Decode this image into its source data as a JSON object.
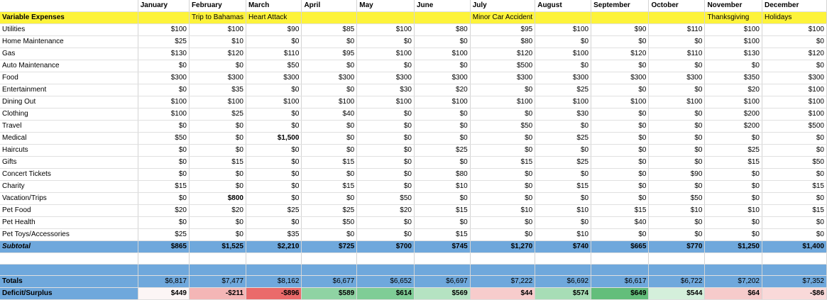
{
  "months": [
    "January",
    "February",
    "March",
    "April",
    "May",
    "June",
    "July",
    "August",
    "September",
    "October",
    "November",
    "December"
  ],
  "events_label": "Variable Expenses",
  "events": [
    "",
    "Trip to Bahamas",
    "Heart Attack",
    "",
    "",
    "",
    "Minor Car Accident",
    "",
    "",
    "",
    "Thanksgiving",
    "Holidays"
  ],
  "expenses": [
    {
      "label": "Utilities",
      "values": [
        "$100",
        "$100",
        "$90",
        "$85",
        "$100",
        "$80",
        "$95",
        "$100",
        "$90",
        "$110",
        "$100",
        "$100"
      ]
    },
    {
      "label": "Home Maintenance",
      "values": [
        "$25",
        "$10",
        "$0",
        "$0",
        "$0",
        "$0",
        "$80",
        "$0",
        "$0",
        "$0",
        "$100",
        "$0"
      ]
    },
    {
      "label": "Gas",
      "values": [
        "$130",
        "$120",
        "$110",
        "$95",
        "$100",
        "$100",
        "$120",
        "$100",
        "$120",
        "$110",
        "$130",
        "$120"
      ]
    },
    {
      "label": "Auto Maintenance",
      "values": [
        "$0",
        "$0",
        "$50",
        "$0",
        "$0",
        "$0",
        "$500",
        "$0",
        "$0",
        "$0",
        "$0",
        "$0"
      ]
    },
    {
      "label": "Food",
      "values": [
        "$300",
        "$300",
        "$300",
        "$300",
        "$300",
        "$300",
        "$300",
        "$300",
        "$300",
        "$300",
        "$350",
        "$300"
      ]
    },
    {
      "label": "Entertainment",
      "values": [
        "$0",
        "$35",
        "$0",
        "$0",
        "$30",
        "$20",
        "$0",
        "$25",
        "$0",
        "$0",
        "$20",
        "$100"
      ]
    },
    {
      "label": "Dining Out",
      "values": [
        "$100",
        "$100",
        "$100",
        "$100",
        "$100",
        "$100",
        "$100",
        "$100",
        "$100",
        "$100",
        "$100",
        "$100"
      ]
    },
    {
      "label": "Clothing",
      "values": [
        "$100",
        "$25",
        "$0",
        "$40",
        "$0",
        "$0",
        "$0",
        "$30",
        "$0",
        "$0",
        "$200",
        "$100"
      ]
    },
    {
      "label": "Travel",
      "values": [
        "$0",
        "$0",
        "$0",
        "$0",
        "$0",
        "$0",
        "$50",
        "$0",
        "$0",
        "$0",
        "$200",
        "$500"
      ]
    },
    {
      "label": "Medical",
      "values": [
        "$50",
        "$0",
        "$1,500",
        "$0",
        "$0",
        "$0",
        "$0",
        "$25",
        "$0",
        "$0",
        "$0",
        "$0"
      ]
    },
    {
      "label": "Haircuts",
      "values": [
        "$0",
        "$0",
        "$0",
        "$0",
        "$0",
        "$25",
        "$0",
        "$0",
        "$0",
        "$0",
        "$25",
        "$0"
      ]
    },
    {
      "label": "Gifts",
      "values": [
        "$0",
        "$15",
        "$0",
        "$15",
        "$0",
        "$0",
        "$15",
        "$25",
        "$0",
        "$0",
        "$15",
        "$50"
      ]
    },
    {
      "label": "Concert Tickets",
      "values": [
        "$0",
        "$0",
        "$0",
        "$0",
        "$0",
        "$80",
        "$0",
        "$0",
        "$0",
        "$90",
        "$0",
        "$0"
      ]
    },
    {
      "label": "Charity",
      "values": [
        "$15",
        "$0",
        "$0",
        "$15",
        "$0",
        "$10",
        "$0",
        "$15",
        "$0",
        "$0",
        "$0",
        "$15"
      ]
    },
    {
      "label": "Vacation/Trips",
      "values": [
        "$0",
        "$800",
        "$0",
        "$0",
        "$50",
        "$0",
        "$0",
        "$0",
        "$0",
        "$50",
        "$0",
        "$0"
      ]
    },
    {
      "label": "Pet Food",
      "values": [
        "$20",
        "$20",
        "$25",
        "$25",
        "$20",
        "$15",
        "$10",
        "$10",
        "$15",
        "$10",
        "$10",
        "$15"
      ]
    },
    {
      "label": "Pet Health",
      "values": [
        "$0",
        "$0",
        "$0",
        "$50",
        "$0",
        "$0",
        "$0",
        "$0",
        "$40",
        "$0",
        "$0",
        "$0"
      ]
    },
    {
      "label": "Pet Toys/Accessories",
      "values": [
        "$25",
        "$0",
        "$35",
        "$0",
        "$0",
        "$15",
        "$0",
        "$10",
        "$0",
        "$0",
        "$0",
        "$0"
      ]
    }
  ],
  "subtotal": {
    "label": "Subtotal",
    "values": [
      "$865",
      "$1,525",
      "$2,210",
      "$725",
      "$700",
      "$745",
      "$1,270",
      "$740",
      "$665",
      "$770",
      "$1,250",
      "$1,400"
    ]
  },
  "totals": {
    "label": "Totals",
    "values": [
      "$6,817",
      "$7,477",
      "$8,162",
      "$6,677",
      "$6,652",
      "$6,697",
      "$7,222",
      "$6,692",
      "$6,617",
      "$6,722",
      "$7,202",
      "$7,352"
    ]
  },
  "deficit": {
    "label": "Deficit/Surplus",
    "values": [
      "$449",
      "-$211",
      "-$896",
      "$589",
      "$614",
      "$569",
      "$44",
      "$574",
      "$649",
      "$544",
      "$64",
      "-$86"
    ],
    "colors": [
      "#fcf5f5",
      "#f4b6b6",
      "#ea6a6a",
      "#8fd3a3",
      "#7fcd96",
      "#b5e3c2",
      "#f7cccc",
      "#a7ddb6",
      "#63be7b",
      "#d4efdb",
      "#f6cbcb",
      "#f9d9d9"
    ]
  },
  "bold_cells": [
    [
      "Medical",
      2
    ],
    [
      "Vacation/Trips",
      1
    ]
  ],
  "colors": {
    "header_fill": "#fdf33a",
    "subtotal_fill": "#6fa8dc",
    "grid": "#d4d4d4"
  }
}
